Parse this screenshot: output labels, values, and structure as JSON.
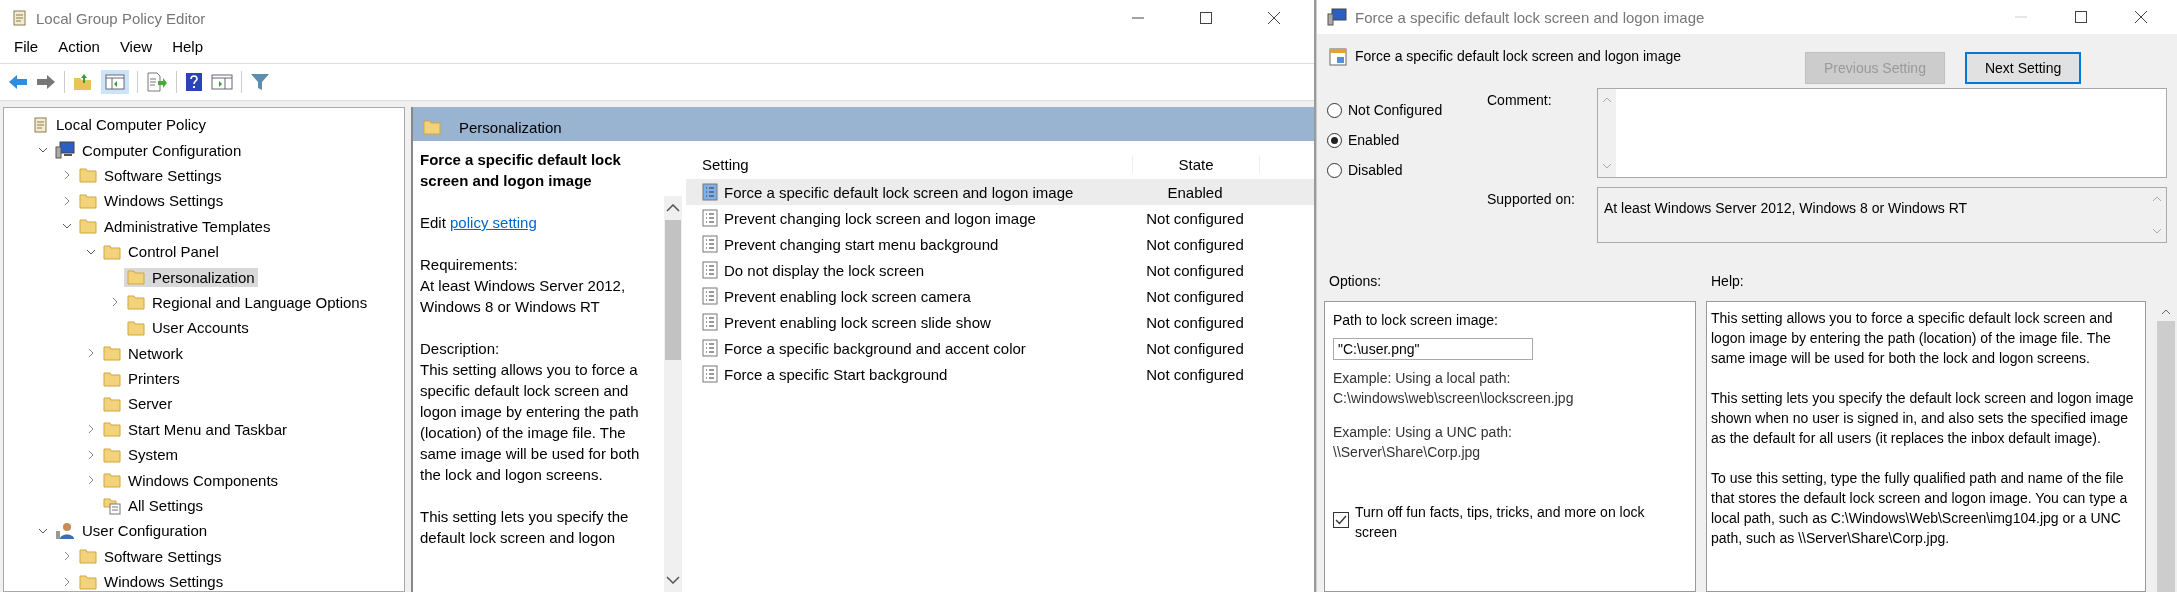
{
  "editor": {
    "title": "Local Group Policy Editor",
    "menu": [
      "File",
      "Action",
      "View",
      "Help"
    ],
    "toolbar": {
      "show_tree_pressed": true
    },
    "tree": [
      {
        "label": "Local Computer Policy",
        "kind": "policy",
        "selected": false,
        "children": [
          {
            "label": "Computer Configuration",
            "kind": "computer",
            "expanded": true,
            "selected": false,
            "children": [
              {
                "label": "Software Settings",
                "kind": "folder",
                "expanded": false,
                "selected": false
              },
              {
                "label": "Windows Settings",
                "kind": "folder",
                "expanded": false,
                "selected": false
              },
              {
                "label": "Administrative Templates",
                "kind": "folder",
                "expanded": true,
                "selected": false,
                "children": [
                  {
                    "label": "Control Panel",
                    "kind": "folder",
                    "expanded": true,
                    "selected": false,
                    "children": [
                      {
                        "label": "Personalization",
                        "kind": "folder",
                        "selected": true
                      },
                      {
                        "label": "Regional and Language Options",
                        "kind": "folder",
                        "expanded": false,
                        "selected": false
                      },
                      {
                        "label": "User Accounts",
                        "kind": "folder",
                        "selected": false
                      }
                    ]
                  },
                  {
                    "label": "Network",
                    "kind": "folder",
                    "expanded": false,
                    "selected": false
                  },
                  {
                    "label": "Printers",
                    "kind": "folder",
                    "selected": false
                  },
                  {
                    "label": "Server",
                    "kind": "folder",
                    "selected": false
                  },
                  {
                    "label": "Start Menu and Taskbar",
                    "kind": "folder",
                    "expanded": false,
                    "selected": false
                  },
                  {
                    "label": "System",
                    "kind": "folder",
                    "expanded": false,
                    "selected": false
                  },
                  {
                    "label": "Windows Components",
                    "kind": "folder",
                    "expanded": false,
                    "selected": false
                  },
                  {
                    "label": "All Settings",
                    "kind": "settings",
                    "selected": false
                  }
                ]
              }
            ]
          },
          {
            "label": "User Configuration",
            "kind": "user",
            "expanded": true,
            "selected": false,
            "children": [
              {
                "label": "Software Settings",
                "kind": "folder",
                "expanded": false,
                "selected": false
              },
              {
                "label": "Windows Settings",
                "kind": "folder",
                "expanded": false,
                "selected": false
              }
            ]
          }
        ]
      }
    ],
    "header": "Personalization",
    "details": {
      "title": "Force a specific default lock screen and logon image",
      "edit_prefix": "Edit",
      "edit_link": "policy setting",
      "requirements_label": "Requirements:",
      "requirements": "At least Windows Server 2012, Windows 8 or Windows RT",
      "description_label": "Description:",
      "paragraphs": [
        "This setting allows you to force a specific default lock screen and logon image by entering the path (location) of the image file. The same image will be used for both the lock and logon screens.",
        "This setting lets you specify the default lock screen and logon"
      ]
    },
    "table": {
      "columns": [
        "Setting",
        "State"
      ],
      "rows": [
        {
          "setting": "Force a specific default lock screen and logon image",
          "state": "Enabled",
          "selected": true
        },
        {
          "setting": "Prevent changing lock screen and logon image",
          "state": "Not configured",
          "selected": false
        },
        {
          "setting": "Prevent changing start menu background",
          "state": "Not configured",
          "selected": false
        },
        {
          "setting": "Do not display the lock screen",
          "state": "Not configured",
          "selected": false
        },
        {
          "setting": "Prevent enabling lock screen camera",
          "state": "Not configured",
          "selected": false
        },
        {
          "setting": "Prevent enabling lock screen slide show",
          "state": "Not configured",
          "selected": false
        },
        {
          "setting": "Force a specific background and accent color",
          "state": "Not configured",
          "selected": false
        },
        {
          "setting": "Force a specific Start background",
          "state": "Not configured",
          "selected": false
        }
      ]
    }
  },
  "dialog": {
    "title": "Force a specific default lock screen and logon image",
    "setting_title": "Force a specific default lock screen and logon image",
    "buttons": [
      {
        "label": "Previous Setting",
        "disabled": true,
        "focused": false
      },
      {
        "label": "Next Setting",
        "disabled": false,
        "focused": true
      }
    ],
    "radios": [
      {
        "label": "Not Configured",
        "selected": false
      },
      {
        "label": "Enabled",
        "selected": true
      },
      {
        "label": "Disabled",
        "selected": false
      }
    ],
    "comment_label": "Comment:",
    "supported_label": "Supported on:",
    "supported_value": "At least Windows Server 2012, Windows 8 or Windows RT",
    "options_label": "Options:",
    "help_label": "Help:",
    "options": {
      "path_label": "Path to lock screen image:",
      "path_value": "\"C:\\user.png\"",
      "examples": [
        {
          "label": "Example: Using a local path:",
          "value": "C:\\windows\\web\\screen\\lockscreen.jpg"
        },
        {
          "label": "Example: Using a UNC path:",
          "value": "\\\\Server\\Share\\Corp.jpg"
        }
      ],
      "checkbox": {
        "label": "Turn off fun facts, tips, tricks, and more on lock screen",
        "checked": true
      }
    },
    "help": [
      "This setting allows you to force a specific default lock screen and logon image by entering the path (location) of the image file. The same image will be used for both the lock and logon screens.",
      "This setting lets you specify the default lock screen and logon image shown when no user is signed in, and also sets the specified image as the default for all users (it replaces the inbox default image).",
      "To use this setting, type the fully qualified path and name of the file that stores the default lock screen and logon image. You can type a local path, such as C:\\Windows\\Web\\Screen\\img104.jpg or a UNC path, such as \\\\Server\\Share\\Corp.jpg."
    ]
  }
}
